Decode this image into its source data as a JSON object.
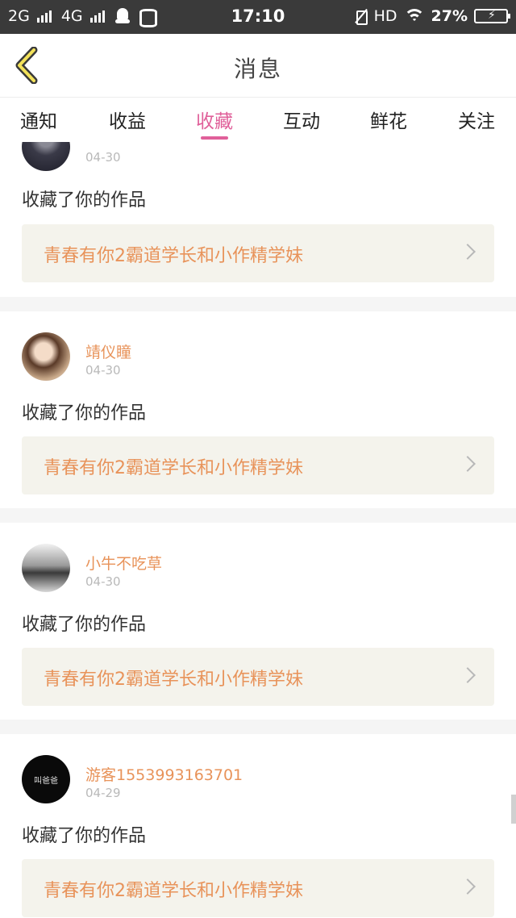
{
  "status_bar": {
    "network1": "2G",
    "network2": "4G",
    "time": "17:10",
    "hd": "HD",
    "battery": "27%"
  },
  "header": {
    "title": "消息",
    "back_icon": "chevron-left-icon"
  },
  "tabs": [
    {
      "label": "通知",
      "active": false
    },
    {
      "label": "收益",
      "active": false
    },
    {
      "label": "收藏",
      "active": true
    },
    {
      "label": "互动",
      "active": false
    },
    {
      "label": "鲜花",
      "active": false
    },
    {
      "label": "关注",
      "active": false
    }
  ],
  "colors": {
    "accent": "#e0609a",
    "username": "#e8935a",
    "work_box_bg": "#f4f3ec"
  },
  "messages": [
    {
      "user": "",
      "date": "04-30",
      "action": "收藏了你的作品",
      "work": "青春有你2霸道学长和小作精学妹"
    },
    {
      "user": "靖仪瞳",
      "date": "04-30",
      "action": "收藏了你的作品",
      "work": "青春有你2霸道学长和小作精学妹"
    },
    {
      "user": "小牛不吃草",
      "date": "04-30",
      "action": "收藏了你的作品",
      "work": "青春有你2霸道学长和小作精学妹"
    },
    {
      "user": "游客1553993163701",
      "date": "04-29",
      "action": "收藏了你的作品",
      "work": "青春有你2霸道学长和小作精学妹",
      "avatar_text": "叫爸爸"
    }
  ]
}
